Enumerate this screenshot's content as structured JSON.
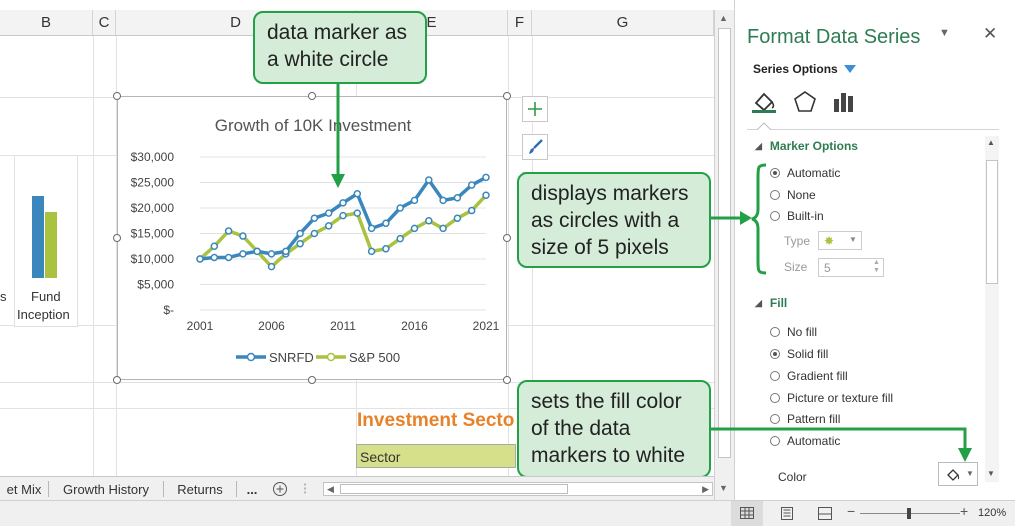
{
  "columns": [
    "B",
    "C",
    "D",
    "E",
    "F",
    "G"
  ],
  "cells": {
    "bar_label_left": "s",
    "bar_label_fund": "Fund",
    "bar_label_inception": "Inception",
    "investment_title": "Investment Secto",
    "sector_header": "Sector"
  },
  "chart_data": {
    "type": "line",
    "title": "Growth of 10K Investment",
    "y_ticks": [
      "$30,000",
      "$25,000",
      "$20,000",
      "$15,000",
      "$10,000",
      "$5,000",
      "$-"
    ],
    "x_ticks": [
      "2001",
      "2006",
      "2011",
      "2016",
      "2021"
    ],
    "ylim": [
      0,
      30000
    ],
    "xlim": [
      2001,
      2021
    ],
    "series": [
      {
        "name": "SNRFD",
        "color": "#3a87bd",
        "x": [
          2001,
          2002,
          2003,
          2004,
          2005,
          2006,
          2007,
          2008,
          2009,
          2010,
          2011,
          2012,
          2013,
          2014,
          2015,
          2016,
          2017,
          2018,
          2019,
          2020,
          2021
        ],
        "values": [
          10000,
          10300,
          10300,
          11000,
          11500,
          11000,
          11500,
          15000,
          18000,
          19000,
          21000,
          22800,
          16000,
          17000,
          20000,
          21500,
          25500,
          21500,
          22000,
          24500,
          26000
        ]
      },
      {
        "name": "S&P 500",
        "color": "#a9c23f",
        "x": [
          2001,
          2002,
          2003,
          2004,
          2005,
          2006,
          2007,
          2008,
          2009,
          2010,
          2011,
          2012,
          2013,
          2014,
          2015,
          2016,
          2017,
          2018,
          2019,
          2020,
          2021
        ],
        "values": [
          10000,
          12500,
          15500,
          14500,
          11500,
          8500,
          11000,
          13000,
          15000,
          16500,
          18500,
          19000,
          11500,
          12000,
          14000,
          16000,
          17500,
          16000,
          18000,
          19500,
          22500
        ]
      }
    ],
    "legend": "bottom",
    "grid": true
  },
  "tabs": [
    "et Mix",
    "Growth History",
    "Returns",
    "..."
  ],
  "status": {
    "zoom": "120%"
  },
  "pane": {
    "title": "Format Data Series",
    "series_options": "Series Options",
    "marker_options": "Marker Options",
    "marker_radios": [
      "Automatic",
      "None",
      "Built-in"
    ],
    "type_label": "Type",
    "size_label": "Size",
    "size_value": "5",
    "fill_label": "Fill",
    "fill_radios": [
      "No fill",
      "Solid fill",
      "Gradient fill",
      "Picture or texture fill",
      "Pattern fill",
      "Automatic"
    ],
    "color_label": "Color"
  },
  "callouts": {
    "marker": "data marker as a white circle",
    "size": "displays markers as circles with a size of 5 pixels",
    "fill": "sets the fill color of the data markers to white"
  },
  "colors": {
    "accent_green": "#22a046",
    "pane_title": "#2e7d52",
    "excel_green": "#217346"
  }
}
